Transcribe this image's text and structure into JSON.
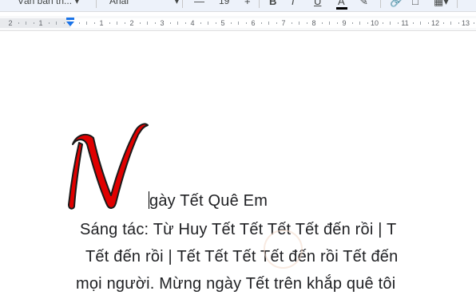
{
  "toolbar": {
    "style_label": "Văn bản th...",
    "font_label": "Arial",
    "font_size": "19",
    "bold_label": "B",
    "italic_label": "I",
    "underline_label": "U",
    "text_color_label": "A"
  },
  "ruler": {
    "labels": [
      "2",
      "1",
      "1",
      "2",
      "3",
      "4",
      "5",
      "6",
      "7",
      "8",
      "9",
      "10",
      "11",
      "12",
      "13"
    ]
  },
  "document": {
    "dropcap_letter": "N",
    "title_rest": "gày Tết Quê Em",
    "lines": [
      "Sáng tác: Từ Huy Tết Tết Tết Tết đến rồi | T",
      "Tết đến rồi | Tết Tết Tết Tết đến rồi Tết đến",
      "mọi người. Mừng ngày Tết trên khắp quê tôi"
    ]
  },
  "colors": {
    "dropcap_fill": "#e00000",
    "accent": "#1a73e8",
    "toolbar_bg": "#edf2fa"
  }
}
